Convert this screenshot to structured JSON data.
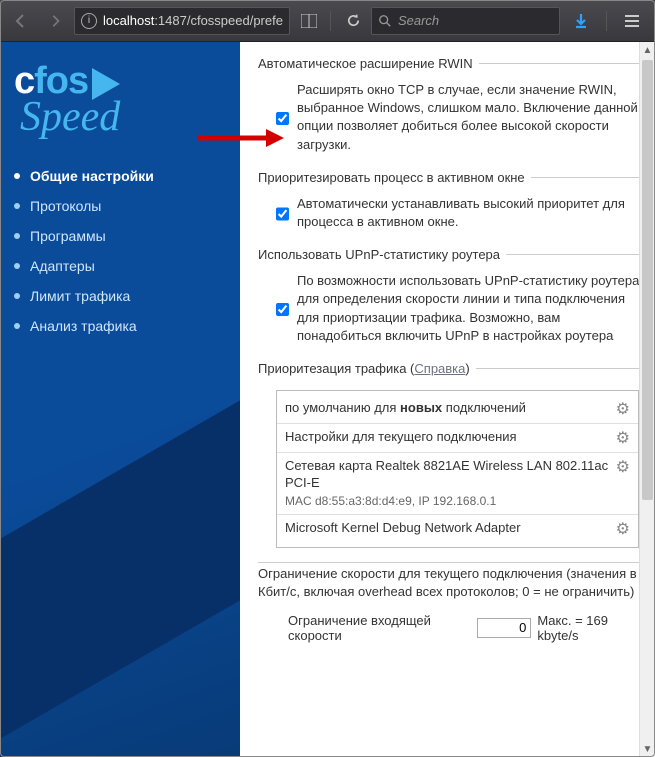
{
  "browser": {
    "url_host": "localhost",
    "url_rest": ":1487/cfosspeed/prefe",
    "search_placeholder": "Search"
  },
  "logo": {
    "c": "c",
    "fos": "fos",
    "speed": "Speed"
  },
  "sidebar": {
    "items": [
      {
        "label": "Общие настройки",
        "active": true
      },
      {
        "label": "Протоколы"
      },
      {
        "label": "Программы"
      },
      {
        "label": "Адаптеры"
      },
      {
        "label": "Лимит трафика"
      },
      {
        "label": "Анализ трафика"
      }
    ]
  },
  "sections": {
    "rwin": {
      "legend": "Автоматическое расширение RWIN",
      "text": "Расширять окно TCP в случае, если значение RWIN, выбранное Windows, слишком мало. Включение данной опции позволяет добиться более высокой скорости загрузки.",
      "checked": true
    },
    "active_window": {
      "legend": "Приоритезировать процесс в активном окне",
      "text": "Автоматически устанавливать высокий приоритет для процесса в активном окне.",
      "checked": true
    },
    "upnp": {
      "legend": "Использовать UPnP-статистику роутера",
      "text": "По возможности использовать UPnP-статистику роутера для определения скорости линии и типа подключения для приортизации трафика. Возможно, вам понадобиться включить UPnP в настройках роутера",
      "checked": true
    },
    "prio": {
      "legend": "Приоритезация трафика",
      "help": "Справка",
      "rows": [
        {
          "label_pre": "по умолчанию для ",
          "bold": "новых",
          "label_post": " подключений"
        },
        {
          "label": "Настройки для текущего подключения"
        },
        {
          "label": "Сетевая карта Realtek 8821AE Wireless LAN 802.11ac PCI-E",
          "sub": "MAC d8:55:a3:8d:d4:e9, IP 192.168.0.1"
        },
        {
          "label": "Microsoft Kernel Debug Network Adapter"
        }
      ]
    },
    "limit": {
      "title": "Ограничение скорости для текущего подключения (значения в Кбит/с, включая overhead всех протоколов; 0 = не ограничить)",
      "in_label": "Ограничение входящей скорости",
      "in_value": "0",
      "in_max": "Макс. = 169 kbyte/s"
    }
  }
}
